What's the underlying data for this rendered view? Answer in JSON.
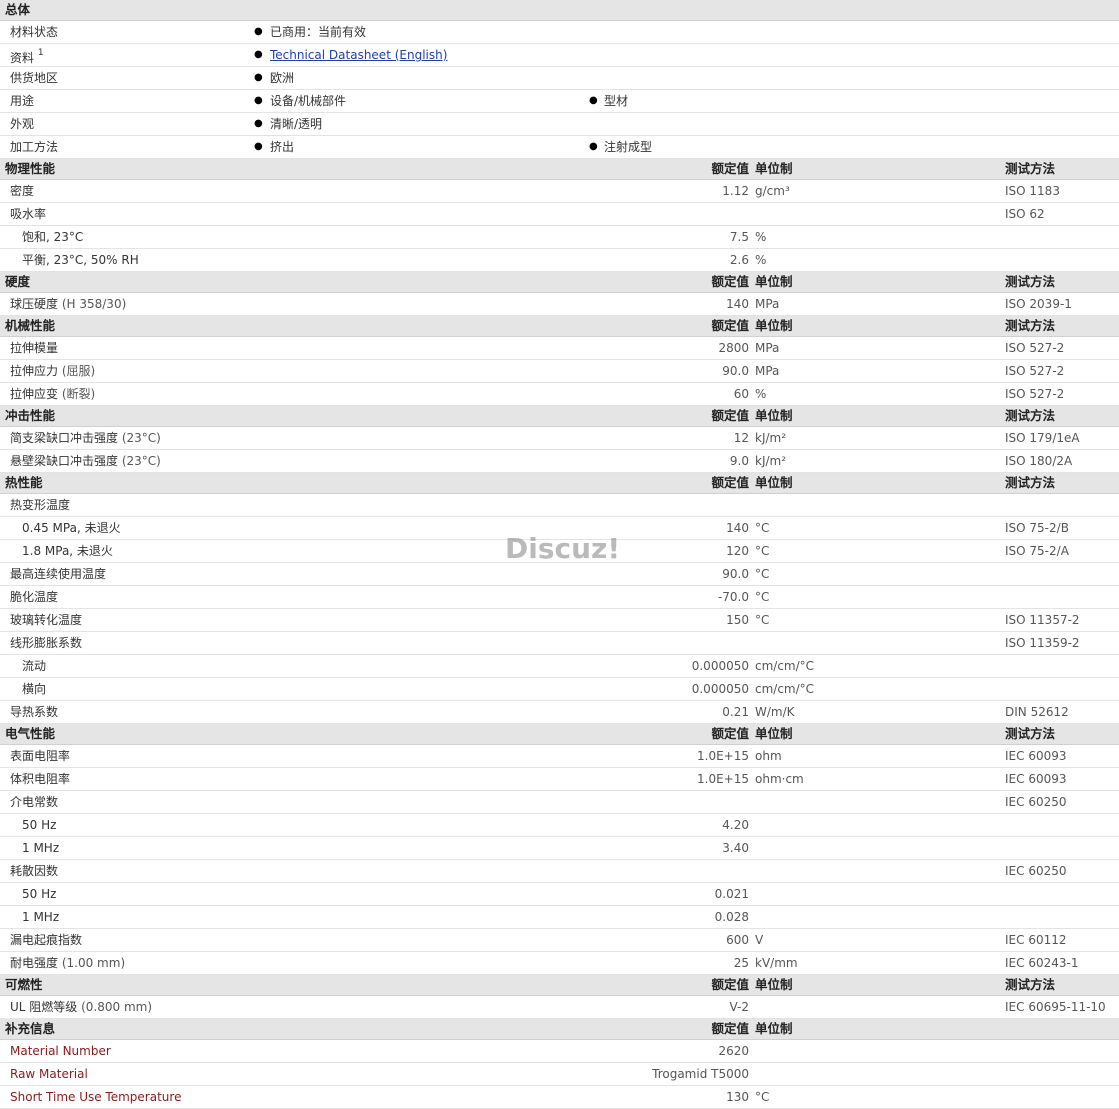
{
  "general": {
    "title": "总体",
    "rows": [
      {
        "label": "材料状态",
        "v1": "已商用：当前有效",
        "v2": ""
      },
      {
        "label": "资料",
        "sup": "1",
        "v1": "Technical Datasheet (English)",
        "v2": "",
        "link": true
      },
      {
        "label": "供货地区",
        "v1": "欧洲",
        "v2": ""
      },
      {
        "label": "用途",
        "v1": "设备/机械部件",
        "v2": "型材"
      },
      {
        "label": "外观",
        "v1": "清晰/透明",
        "v2": ""
      },
      {
        "label": "加工方法",
        "v1": "挤出",
        "v2": "注射成型"
      }
    ]
  },
  "headers": {
    "value": "额定值",
    "unit": "单位制",
    "test": "测试方法"
  },
  "sections": [
    {
      "title": "物理性能",
      "rows": [
        {
          "label": "密度",
          "value": "1.12",
          "unit": "g/cm³",
          "test": "ISO 1183",
          "indent": 0
        },
        {
          "label": "吸水率",
          "value": "",
          "unit": "",
          "test": "ISO 62",
          "indent": 0
        },
        {
          "label": "饱和, 23°C",
          "value": "7.5",
          "unit": "%",
          "test": "",
          "indent": 1
        },
        {
          "label": "平衡, 23°C, 50% RH",
          "value": "2.6",
          "unit": "%",
          "test": "",
          "indent": 1
        }
      ]
    },
    {
      "title": "硬度",
      "rows": [
        {
          "label": "球压硬度",
          "cond": "(H 358/30)",
          "value": "140",
          "unit": "MPa",
          "test": "ISO 2039-1",
          "indent": 0
        }
      ]
    },
    {
      "title": "机械性能",
      "rows": [
        {
          "label": "拉伸模量",
          "value": "2800",
          "unit": "MPa",
          "test": "ISO 527-2",
          "indent": 0
        },
        {
          "label": "拉伸应力",
          "cond": "(屈服)",
          "value": "90.0",
          "unit": "MPa",
          "test": "ISO 527-2",
          "indent": 0
        },
        {
          "label": "拉伸应变",
          "cond": "(断裂)",
          "value": "60",
          "unit": "%",
          "test": "ISO 527-2",
          "indent": 0
        }
      ]
    },
    {
      "title": "冲击性能",
      "rows": [
        {
          "label": "简支梁缺口冲击强度",
          "cond": "(23°C)",
          "value": "12",
          "unit": "kJ/m²",
          "test": "ISO 179/1eA",
          "indent": 0
        },
        {
          "label": "悬壁梁缺口冲击强度",
          "cond": "(23°C)",
          "value": "9.0",
          "unit": "kJ/m²",
          "test": "ISO 180/2A",
          "indent": 0
        }
      ]
    },
    {
      "title": "热性能",
      "rows": [
        {
          "label": "热变形温度",
          "value": "",
          "unit": "",
          "test": "",
          "indent": 0
        },
        {
          "label": "0.45 MPa, 未退火",
          "value": "140",
          "unit": "°C",
          "test": "ISO 75-2/B",
          "indent": 1
        },
        {
          "label": "1.8 MPa, 未退火",
          "value": "120",
          "unit": "°C",
          "test": "ISO 75-2/A",
          "indent": 1
        },
        {
          "label": "最高连续使用温度",
          "value": "90.0",
          "unit": "°C",
          "test": "",
          "indent": 0
        },
        {
          "label": "脆化温度",
          "value": "-70.0",
          "unit": "°C",
          "test": "",
          "indent": 0
        },
        {
          "label": "玻璃转化温度",
          "value": "150",
          "unit": "°C",
          "test": "ISO 11357-2",
          "indent": 0
        },
        {
          "label": "线形膨胀系数",
          "value": "",
          "unit": "",
          "test": "ISO 11359-2",
          "indent": 0
        },
        {
          "label": "流动",
          "value": "0.000050",
          "unit": "cm/cm/°C",
          "test": "",
          "indent": 1
        },
        {
          "label": "横向",
          "value": "0.000050",
          "unit": "cm/cm/°C",
          "test": "",
          "indent": 1
        },
        {
          "label": "导热系数",
          "value": "0.21",
          "unit": "W/m/K",
          "test": "DIN 52612",
          "indent": 0
        }
      ]
    },
    {
      "title": "电气性能",
      "rows": [
        {
          "label": "表面电阻率",
          "value": "1.0E+15",
          "unit": "ohm",
          "test": "IEC 60093",
          "indent": 0
        },
        {
          "label": "体积电阻率",
          "value": "1.0E+15",
          "unit": "ohm·cm",
          "test": "IEC 60093",
          "indent": 0
        },
        {
          "label": "介电常数",
          "value": "",
          "unit": "",
          "test": "IEC 60250",
          "indent": 0
        },
        {
          "label": "50 Hz",
          "value": "4.20",
          "unit": "",
          "test": "",
          "indent": 1
        },
        {
          "label": "1 MHz",
          "value": "3.40",
          "unit": "",
          "test": "",
          "indent": 1
        },
        {
          "label": "耗散因数",
          "value": "",
          "unit": "",
          "test": "IEC 60250",
          "indent": 0
        },
        {
          "label": "50 Hz",
          "value": "0.021",
          "unit": "",
          "test": "",
          "indent": 1
        },
        {
          "label": "1 MHz",
          "value": "0.028",
          "unit": "",
          "test": "",
          "indent": 1
        },
        {
          "label": "漏电起痕指数",
          "value": "600",
          "unit": "V",
          "test": "IEC 60112",
          "indent": 0
        },
        {
          "label": "耐电强度",
          "cond": "(1.00 mm)",
          "value": "25",
          "unit": "kV/mm",
          "test": "IEC 60243-1",
          "indent": 0
        }
      ]
    },
    {
      "title": "可燃性",
      "rows": [
        {
          "label": "UL 阻燃等级",
          "cond": "(0.800 mm)",
          "value": "V-2",
          "unit": "",
          "test": "IEC 60695-11-10",
          "indent": 0
        }
      ]
    },
    {
      "title": "补充信息",
      "showTest": false,
      "rows": [
        {
          "label": "Material Number",
          "value": "2620",
          "unit": "",
          "test": "",
          "indent": 0,
          "maroon": true
        },
        {
          "label": "Raw Material",
          "value": "Trogamid T5000",
          "unit": "",
          "test": "",
          "indent": 0,
          "maroon": true
        },
        {
          "label": "Short Time Use Temperature",
          "value": "130",
          "unit": "°C",
          "test": "",
          "indent": 0,
          "maroon": true
        }
      ]
    }
  ],
  "watermark": "Discuz!"
}
